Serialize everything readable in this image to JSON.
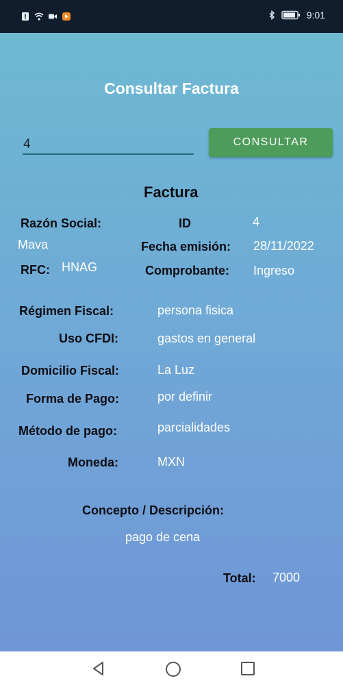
{
  "status_bar": {
    "left_icons": [
      "sim-alert-icon",
      "wifi-icon",
      "video-icon",
      "app-notification-icon"
    ],
    "right_icons": [
      "bluetooth-icon",
      "battery-icon"
    ],
    "time": "9:01"
  },
  "page": {
    "title": "Consultar Factura",
    "search_input": {
      "value": "4",
      "placeholder": ""
    },
    "consult_button": "CONSULTAR"
  },
  "invoice": {
    "heading": "Factura",
    "razon_social_label": "Razón Social:",
    "razon_social_value": "Mava",
    "id_label": "ID",
    "id_value": "4",
    "fecha_emision_label": "Fecha emisión:",
    "fecha_emision_value": "28/11/2022",
    "rfc_label": "RFC:",
    "rfc_value": "HNAG",
    "comprobante_label": "Comprobante:",
    "comprobante_value": "Ingreso",
    "regimen_fiscal_label": "Régimen Fiscal:",
    "regimen_fiscal_value": "persona fisica",
    "uso_cfdi_label": "Uso CFDI:",
    "uso_cfdi_value": "gastos en general",
    "domicilio_fiscal_label": "Domicilio Fiscal:",
    "domicilio_fiscal_value": "La Luz",
    "forma_pago_label": "Forma de Pago:",
    "forma_pago_value": "por definir",
    "metodo_pago_label": "Método de pago:",
    "metodo_pago_value": "parcialidades",
    "moneda_label": "Moneda:",
    "moneda_value": "MXN",
    "concepto_label": "Concepto / Descripción:",
    "concepto_value": "pago de cena",
    "total_label": "Total:",
    "total_value": "7000"
  },
  "colors": {
    "status_bar": "#0f1d2c",
    "gradient_top": "#6db9d2",
    "gradient_bottom": "#6f96d6",
    "button": "#4e9c5b",
    "input_underline": "#1d6f7d"
  },
  "nav_bar": {
    "icons": [
      "back-icon",
      "home-icon",
      "recents-icon"
    ]
  }
}
